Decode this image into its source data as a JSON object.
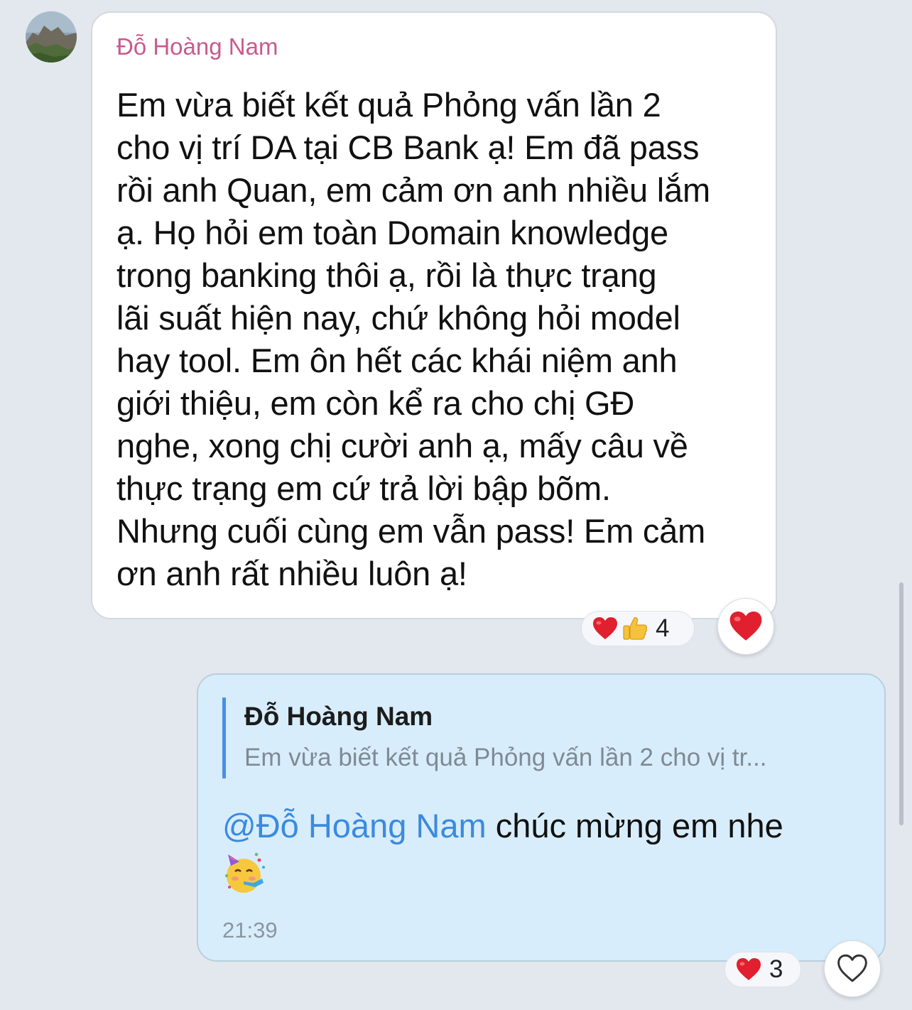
{
  "incoming": {
    "avatar_icon": "landscape-avatar-icon",
    "sender": "Đỗ Hoàng Nam",
    "sender_color": "#c85a8e",
    "text": "Em vừa biết kết quả Phỏng vấn lần 2\ncho vị trí DA tại CB Bank ạ! Em đã pass\nrồi anh Quan, em cảm ơn anh nhiều lắm\nạ. Họ hỏi em toàn Domain knowledge\ntrong banking thôi ạ, rồi là thực trạng\nlãi suất hiện nay, chứ không hỏi model\nhay tool. Em ôn hết các khái niệm anh\ngiới thiệu, em còn kể ra cho chị GĐ\nnghe, xong chị cười anh ạ, mấy câu về\nthực trạng em cứ trả lời bập bõm.\nNhưng cuối cùng em vẫn pass! Em cảm\nơn anh rất nhiều luôn ạ!",
    "reactions": {
      "icons": [
        "red-heart-icon",
        "thumbs-up-icon"
      ],
      "count": "4"
    },
    "react_button_icon": "red-heart-icon"
  },
  "outgoing": {
    "quote": {
      "author": "Đỗ Hoàng Nam",
      "text": "Em vừa biết kết quả Phỏng vấn lần 2 cho vị tr..."
    },
    "mention": "@Đỗ Hoàng Nam",
    "text": " chúc mừng em nhe",
    "emoji": "partying-face-icon",
    "time": "21:39",
    "reactions": {
      "icons": [
        "red-heart-icon"
      ],
      "count": "3"
    },
    "react_button_icon": "outline-heart-icon"
  },
  "colors": {
    "background": "#e3e8ee",
    "outgoing_bubble": "#d8edfb",
    "mention": "#3a8ae0",
    "quote_bar": "#4a90e2",
    "heart": "#e0202e"
  }
}
